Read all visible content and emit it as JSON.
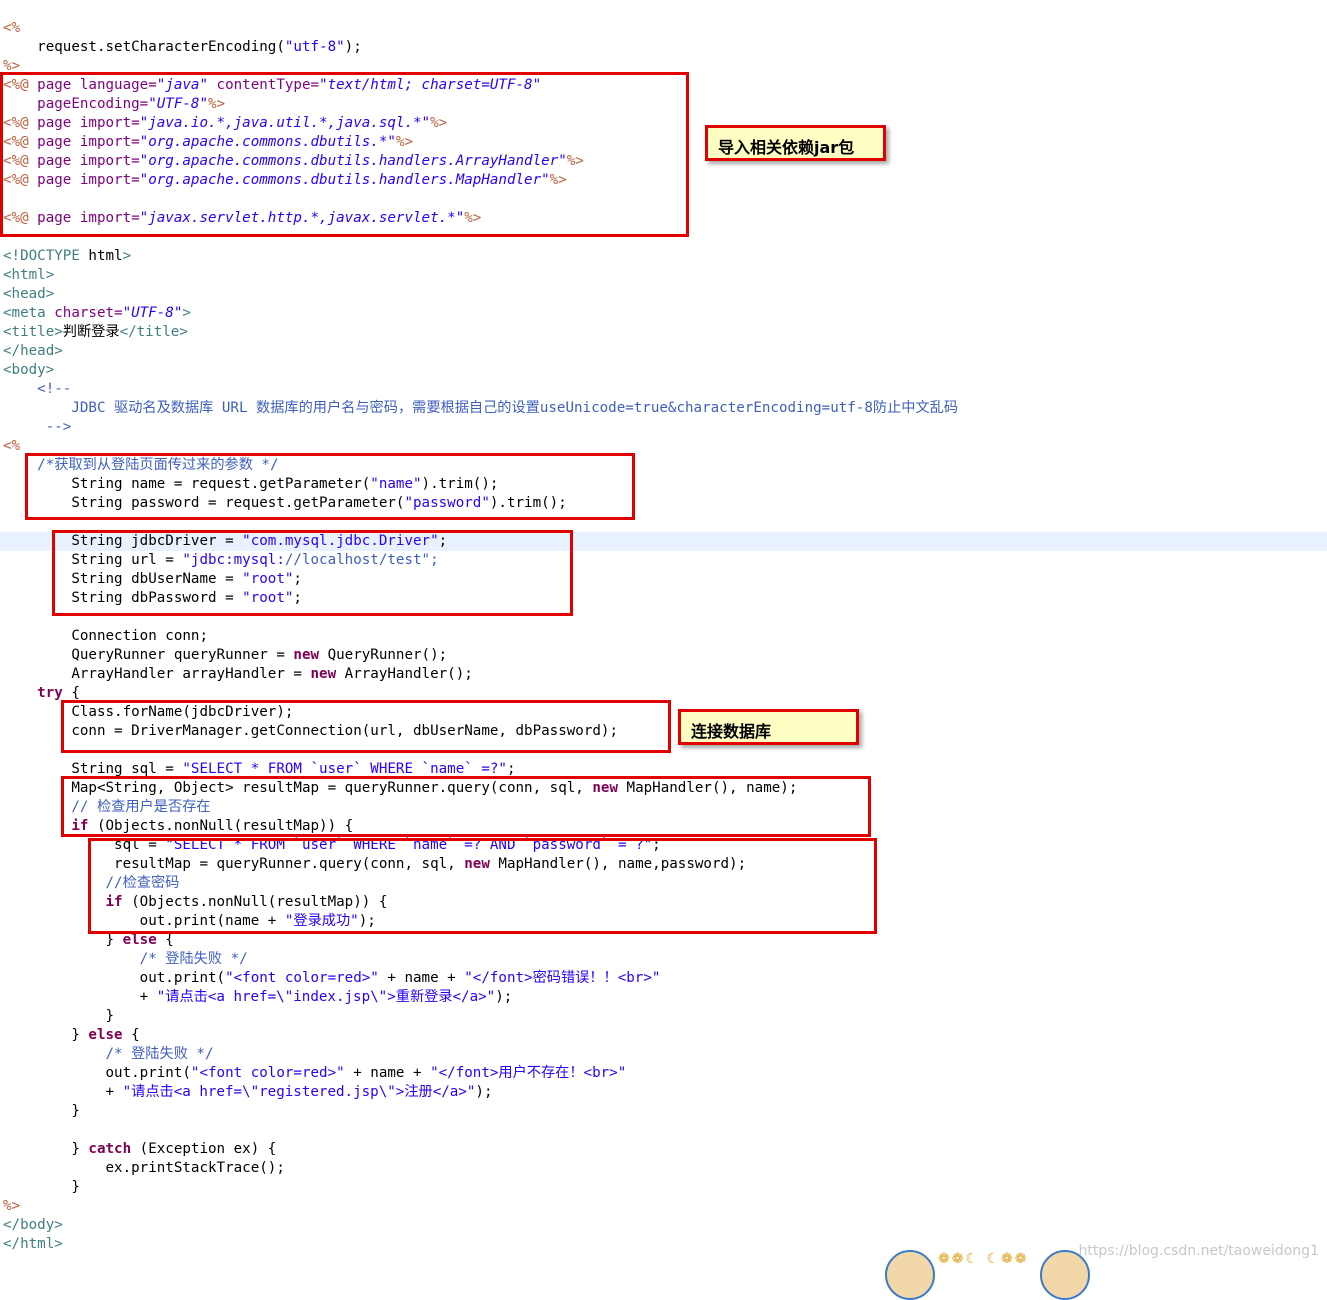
{
  "code_lines": [
    "<%",
    "    request.setCharacterEncoding(\"utf-8\");",
    "%>",
    "<%@ page language=\"java\" contentType=\"text/html; charset=UTF-8\"",
    "    pageEncoding=\"UTF-8\"%>",
    "<%@ page import=\"java.io.*,java.util.*,java.sql.*\"%>",
    "<%@ page import=\"org.apache.commons.dbutils.*\"%>",
    "<%@ page import=\"org.apache.commons.dbutils.handlers.ArrayHandler\"%>",
    "<%@ page import=\"org.apache.commons.dbutils.handlers.MapHandler\"%>",
    "",
    "<%@ page import=\"javax.servlet.http.*,javax.servlet.*\"%>",
    "",
    "<!DOCTYPE html>",
    "<html>",
    "<head>",
    "<meta charset=\"UTF-8\">",
    "<title>判断登录</title>",
    "</head>",
    "<body>",
    "    <!--",
    "        JDBC 驱动名及数据库 URL 数据库的用户名与密码，需要根据自己的设置useUnicode=true&characterEncoding=utf-8防止中文乱码",
    "     -->",
    "<%",
    "    /*获取到从登陆页面传过来的参数 */",
    "        String name = request.getParameter(\"name\").trim();",
    "        String password = request.getParameter(\"password\").trim();",
    "",
    "        String jdbcDriver = \"com.mysql.jdbc.Driver\";",
    "        String url = \"jdbc:mysql://localhost/test\";",
    "        String dbUserName = \"root\";",
    "        String dbPassword = \"root\";",
    "",
    "        Connection conn;",
    "        QueryRunner queryRunner = new QueryRunner();",
    "        ArrayHandler arrayHandler = new ArrayHandler();",
    "    try {",
    "        Class.forName(jdbcDriver);",
    "        conn = DriverManager.getConnection(url, dbUserName, dbPassword);",
    "",
    "        String sql = \"SELECT * FROM `user` WHERE `name` =?\";",
    "        Map<String, Object> resultMap = queryRunner.query(conn, sql, new MapHandler(), name);",
    "        // 检查用户是否存在",
    "        if (Objects.nonNull(resultMap)) {",
    "             sql = \"SELECT * FROM `user` WHERE `name` =? AND `password` = ?\";",
    "             resultMap = queryRunner.query(conn, sql, new MapHandler(), name,password);",
    "            //检查密码",
    "            if (Objects.nonNull(resultMap)) {",
    "                out.print(name + \"登录成功\");",
    "            } else {",
    "                /* 登陆失败 */",
    "                out.print(\"<font color=red>\" + name + \"</font>密码错误！！<br>\"",
    "                + \"请点击<a href=\\\"index.jsp\\\">重新登录</a>\");",
    "            }",
    "        } else {",
    "            /* 登陆失败 */",
    "            out.print(\"<font color=red>\" + name + \"</font>用户不存在！<br>\"",
    "            + \"请点击<a href=\\\"registered.jsp\\\">注册</a>\");",
    "        }",
    "",
    "        } catch (Exception ex) {",
    "            ex.printStackTrace();",
    "        }",
    "%>",
    "</body>",
    "</html>"
  ],
  "annotations": {
    "import_note": "导入相关依赖jar包",
    "connect_note": "连接数据库"
  },
  "watermark": "https://blog.csdn.net/taoweidong1",
  "colors": {
    "tag": "#3f7f7f",
    "jsp_delim": "#bf5f3f",
    "keyword": "#7f0055",
    "string": "#2a00ff",
    "comment": "#3f5fbf",
    "attribute": "#7f007f",
    "highlight_box": "#e00000",
    "note_bg": "#ffffc4",
    "current_line": "#e8f2fe"
  }
}
